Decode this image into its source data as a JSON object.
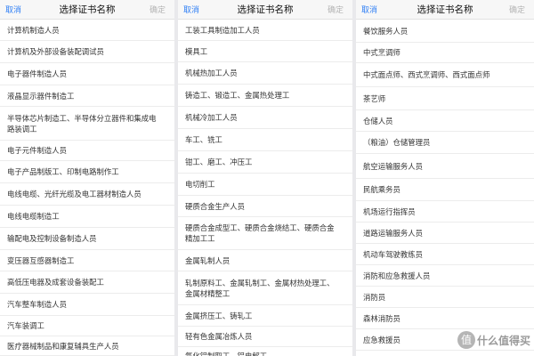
{
  "panels": [
    {
      "cancel": "取消",
      "title": "选择证书名称",
      "confirm": "确定",
      "items": [
        "计算机制造人员",
        "计算机及外部设备装配调试员",
        "电子器件制造人员",
        "液晶显示器件制造工",
        "半导体芯片制造工、半导体分立器件和集成电路装调工",
        "电子元件制造人员",
        "电子产品制版工、印制电路制作工",
        "电线电缆、光纤光缆及电工器材制造人员",
        "电线电缆制造工",
        "输配电及控制设备制造人员",
        "变压器互感器制造工",
        "高低压电器及成套设备装配工",
        "汽车整车制造人员",
        "汽车装调工",
        "医疗器械制品和康复辅具生产人员"
      ]
    },
    {
      "cancel": "取消",
      "title": "选择证书名称",
      "confirm": "确定",
      "items": [
        "工装工具制造加工人员",
        "模具工",
        "机械热加工人员",
        "铸造工、锻造工、金属热处理工",
        "机械冷加工人员",
        "车工、铣工",
        "钳工、磨工、冲压工",
        "电切削工",
        "硬质合金生产人员",
        "硬质合金成型工、硬质合金烧结工、硬质合金精加工工",
        "金属轧制人员",
        "轧制原料工、金属轧制工、金属材热处理工、金属材精整工",
        "金属挤压工、铸轧工",
        "轻有色金属冶炼人员",
        "氧化铝制取工、铝电解工"
      ]
    },
    {
      "cancel": "取消",
      "title": "选择证书名称",
      "confirm": "确定",
      "items": [
        "餐饮服务人员",
        "中式烹调师",
        "中式面点师、西式烹调师、西式面点师",
        "茶艺师",
        "仓储人员",
        "（粮油）仓储管理员",
        "航空运输服务人员",
        "民航乘务员",
        "机场运行指挥员",
        "道路运输服务人员",
        "机动车驾驶教练员",
        "消防和应急救援人员",
        "消防员",
        "森林消防员",
        "应急救援员"
      ]
    }
  ],
  "watermark": {
    "badge": "值",
    "text": "什么值得买"
  }
}
